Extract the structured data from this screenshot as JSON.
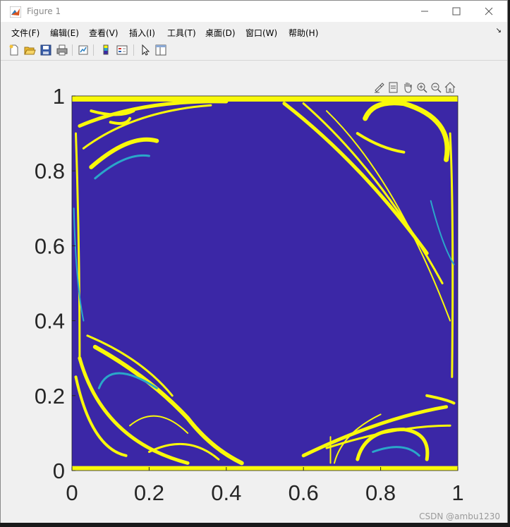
{
  "window": {
    "title": "Figure 1"
  },
  "menu": {
    "items": [
      {
        "label": "文件(F)",
        "name": "menu-file"
      },
      {
        "label": "编辑(E)",
        "name": "menu-edit"
      },
      {
        "label": "查看(V)",
        "name": "menu-view"
      },
      {
        "label": "插入(I)",
        "name": "menu-insert"
      },
      {
        "label": "工具(T)",
        "name": "menu-tools"
      },
      {
        "label": "桌面(D)",
        "name": "menu-desktop"
      },
      {
        "label": "窗口(W)",
        "name": "menu-window"
      },
      {
        "label": "帮助(H)",
        "name": "menu-help"
      }
    ]
  },
  "toolbar": {
    "icons": [
      "new-figure-icon",
      "open-file-icon",
      "save-icon",
      "print-icon",
      "link-plot-icon",
      "colorbar-icon",
      "legend-icon",
      "edit-plot-icon",
      "property-inspector-icon"
    ]
  },
  "axes_toolbar": {
    "icons": [
      "brush-icon",
      "data-tips-icon",
      "pan-icon",
      "zoom-in-icon",
      "zoom-out-icon",
      "home-icon"
    ]
  },
  "colors": {
    "background": "#3b27a6",
    "foreground": "#f9f90a",
    "accent_edge": "#2aa7c9"
  },
  "chart_data": {
    "type": "heatmap",
    "title": "",
    "xlabel": "",
    "ylabel": "",
    "xlim": [
      0,
      1
    ],
    "ylim": [
      0,
      1
    ],
    "xticks": [
      "0",
      "0.2",
      "0.4",
      "0.6",
      "0.8",
      "1"
    ],
    "yticks": [
      "0",
      "0.2",
      "0.4",
      "0.6",
      "0.8",
      "1"
    ],
    "colormap": [
      "#3b27a6",
      "#2aa7c9",
      "#f9f90a"
    ],
    "values_description_note": ""
  },
  "watermark": "CSDN @ambu1230"
}
